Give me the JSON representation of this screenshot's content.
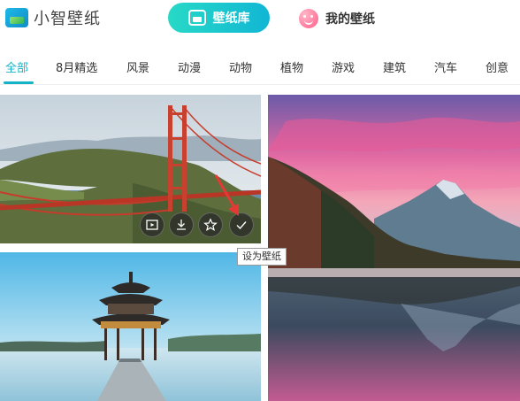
{
  "app": {
    "title": "小智壁纸",
    "logo_icon": "image-icon"
  },
  "header": {
    "tabs": [
      {
        "label": "壁纸库",
        "icon": "image-icon",
        "active": true,
        "color": "#14b4c8"
      },
      {
        "label": "我的壁纸",
        "icon": "smiley-icon",
        "active": false
      }
    ]
  },
  "categories": [
    {
      "label": "全部",
      "active": true
    },
    {
      "label": "8月精选"
    },
    {
      "label": "风景"
    },
    {
      "label": "动漫"
    },
    {
      "label": "动物"
    },
    {
      "label": "植物"
    },
    {
      "label": "游戏"
    },
    {
      "label": "建筑"
    },
    {
      "label": "汽车"
    },
    {
      "label": "创意"
    }
  ],
  "wallpapers": [
    {
      "subject": "golden-gate-bridge",
      "hovered": true
    },
    {
      "subject": "mountain-lake-sunset"
    },
    {
      "subject": "lake-pavilion"
    }
  ],
  "hover_actions": [
    {
      "icon": "preview-icon"
    },
    {
      "icon": "download-icon"
    },
    {
      "icon": "star-icon"
    },
    {
      "icon": "check-icon"
    }
  ],
  "tooltip": {
    "text": "设为壁纸"
  },
  "colors": {
    "accent": "#14b4c8",
    "annotation_arrow": "#e53935"
  }
}
